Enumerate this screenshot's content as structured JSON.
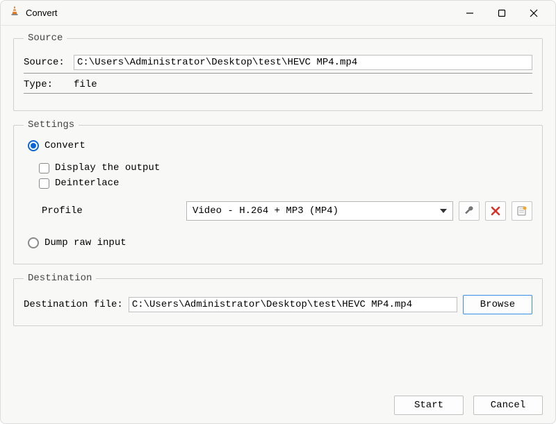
{
  "window": {
    "title": "Convert"
  },
  "source_group": {
    "legend": "Source",
    "source_label": "Source:",
    "source_value": "C:\\Users\\Administrator\\Desktop\\test\\HEVC MP4.mp4",
    "type_label": "Type:",
    "type_value": "file"
  },
  "settings_group": {
    "legend": "Settings",
    "convert_label": "Convert",
    "display_output_label": "Display the output",
    "deinterlace_label": "Deinterlace",
    "profile_label": "Profile",
    "profile_value": "Video - H.264 + MP3 (MP4)",
    "dump_label": "Dump raw input"
  },
  "destination_group": {
    "legend": "Destination",
    "dest_label": "Destination file:",
    "dest_value": "C:\\Users\\Administrator\\Desktop\\test\\HEVC MP4.mp4",
    "browse_label": "Browse"
  },
  "footer": {
    "start_label": "Start",
    "cancel_label": "Cancel"
  }
}
